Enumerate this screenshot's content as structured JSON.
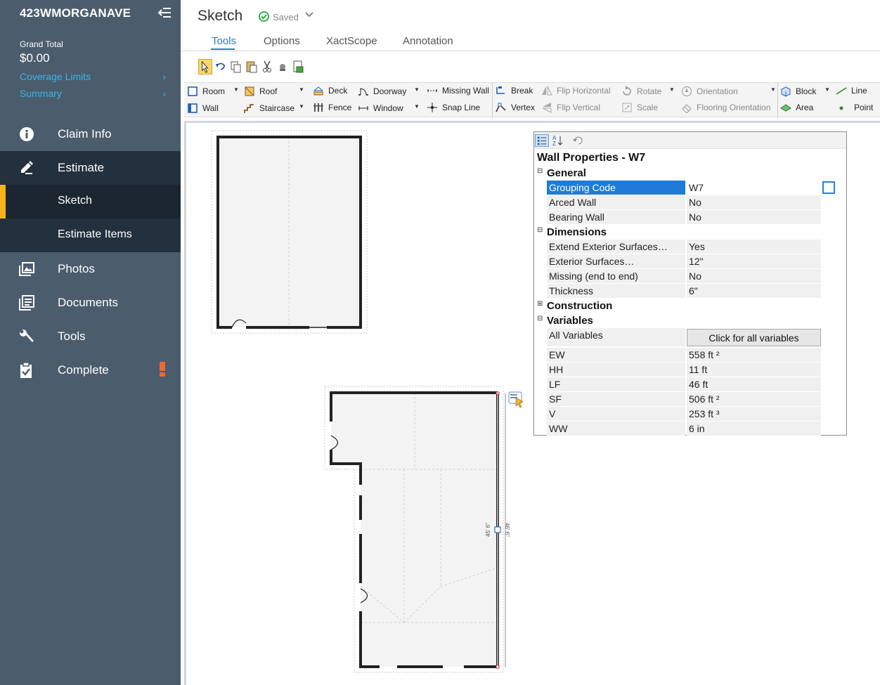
{
  "sidebar": {
    "title": "423WMORGANAVE",
    "grand_total_label": "Grand Total",
    "grand_total_value": "$0.00",
    "links": [
      {
        "label": "Coverage Limits"
      },
      {
        "label": "Summary"
      }
    ],
    "nav": {
      "claim_info": "Claim Info",
      "estimate": "Estimate",
      "sketch": "Sketch",
      "estimate_items": "Estimate Items",
      "photos": "Photos",
      "documents": "Documents",
      "tools": "Tools",
      "complete": "Complete"
    }
  },
  "header": {
    "title": "Sketch",
    "status": "Saved",
    "tabs": [
      "Tools",
      "Options",
      "XactScope",
      "Annotation"
    ]
  },
  "toolbar": {
    "tools": {
      "room": "Room",
      "wall": "Wall",
      "roof": "Roof",
      "staircase": "Staircase",
      "deck": "Deck",
      "fence": "Fence",
      "doorway": "Doorway",
      "window": "Window",
      "missing_wall": "Missing Wall",
      "snap_line": "Snap Line",
      "break": "Break",
      "vertex": "Vertex",
      "flip_horizontal": "Flip Horizontal",
      "flip_vertical": "Flip Vertical",
      "rotate": "Rotate",
      "scale": "Scale",
      "orientation": "Orientation",
      "flooring_orientation": "Flooring Orientation",
      "block": "Block",
      "area": "Area",
      "line": "Line",
      "point": "Point"
    }
  },
  "sketch": {
    "dim_label_left": "45' 6\"",
    "dim_label_right": "46' 6\""
  },
  "properties": {
    "title": "Wall Properties - W7",
    "categories": {
      "general": "General",
      "dimensions": "Dimensions",
      "construction": "Construction",
      "variables": "Variables"
    },
    "general": [
      {
        "name": "Grouping Code",
        "value": "W7"
      },
      {
        "name": "Arced Wall",
        "value": "No"
      },
      {
        "name": "Bearing Wall",
        "value": "No"
      }
    ],
    "dimensions": [
      {
        "name": "Extend Exterior Surfaces…",
        "value": "Yes"
      },
      {
        "name": "Exterior  Surfaces…",
        "value": "12\""
      },
      {
        "name": "Missing (end to end)",
        "value": "No"
      },
      {
        "name": "Thickness",
        "value": "6\""
      }
    ],
    "variables_all_label": "All Variables",
    "variables_button": "Click for all variables",
    "variables": [
      {
        "name": "EW",
        "value": "558 ft ²"
      },
      {
        "name": "HH",
        "value": "11 ft"
      },
      {
        "name": "LF",
        "value": "46 ft"
      },
      {
        "name": "SF",
        "value": "506 ft ²"
      },
      {
        "name": "V",
        "value": "253 ft ³"
      },
      {
        "name": "WW",
        "value": "6 in"
      }
    ]
  },
  "colors": {
    "sidebar_bg": "#4b5c6d",
    "sidebar_active": "#23303d",
    "accent": "#f5b21a",
    "link": "#35b7e8",
    "selection": "#1f7bd8"
  }
}
